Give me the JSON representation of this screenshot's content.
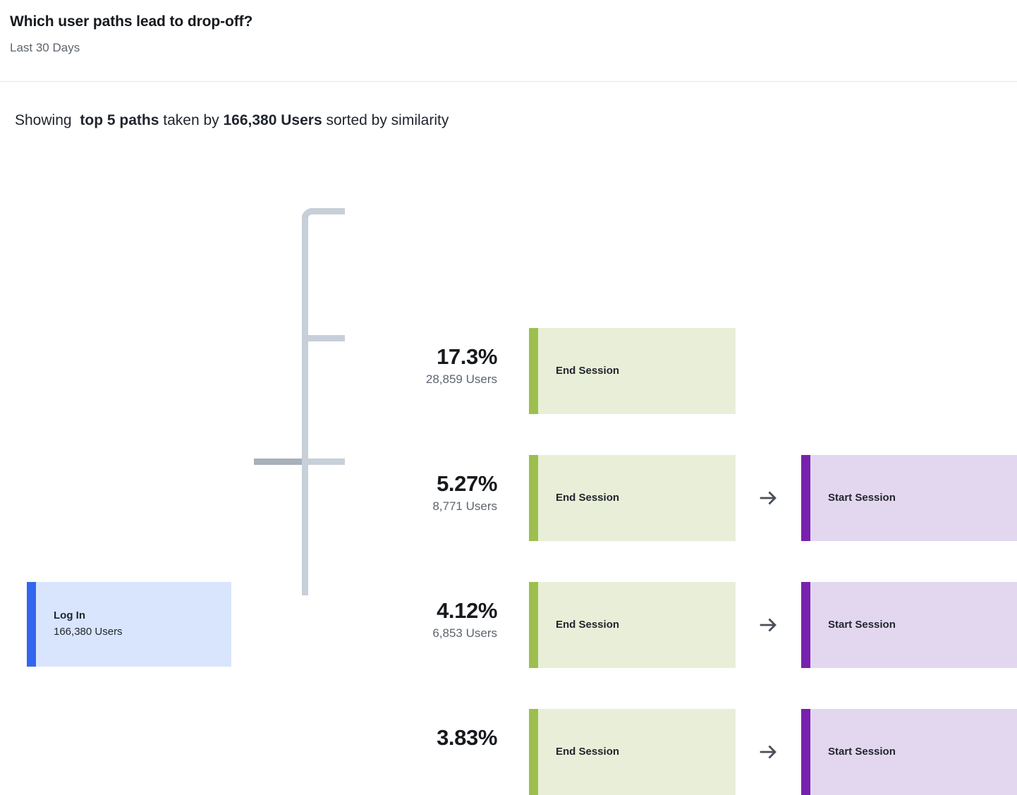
{
  "header": {
    "title": "Which user paths lead to drop-off?",
    "subtitle": "Last 30 Days"
  },
  "showing": {
    "prefix": "Showing",
    "paths_label": "top 5 paths",
    "middle": "taken by",
    "users_label": "166,380 Users",
    "suffix": "sorted by similarity"
  },
  "colors": {
    "source_accent": "#3366ee",
    "source_body": "#d8e5fc",
    "end_accent": "#9cbf4e",
    "end_body": "#e9eed8",
    "start_accent": "#7721ae",
    "start_body": "#e3d7ef",
    "connector": "#c7cfd8",
    "connector_incoming": "#a8b0ba",
    "arrow": "#4a4f58"
  },
  "source_node": {
    "label": "Log In",
    "users": "166,380 Users"
  },
  "icons": {
    "arrow": "arrow-right-icon"
  },
  "paths": [
    {
      "percent": "17.3%",
      "users": "28,859 Users",
      "steps": [
        {
          "label": "End Session",
          "type": "end"
        }
      ]
    },
    {
      "percent": "5.27%",
      "users": "8,771 Users",
      "steps": [
        {
          "label": "End Session",
          "type": "end"
        },
        {
          "label": "Start Session",
          "type": "start"
        }
      ]
    },
    {
      "percent": "4.12%",
      "users": "6,853 Users",
      "steps": [
        {
          "label": "End Session",
          "type": "end"
        },
        {
          "label": "Start Session",
          "type": "start"
        }
      ]
    },
    {
      "percent": "3.83%",
      "users": "",
      "steps": [
        {
          "label": "End Session",
          "type": "end"
        },
        {
          "label": "Start Session",
          "type": "start"
        }
      ]
    }
  ]
}
